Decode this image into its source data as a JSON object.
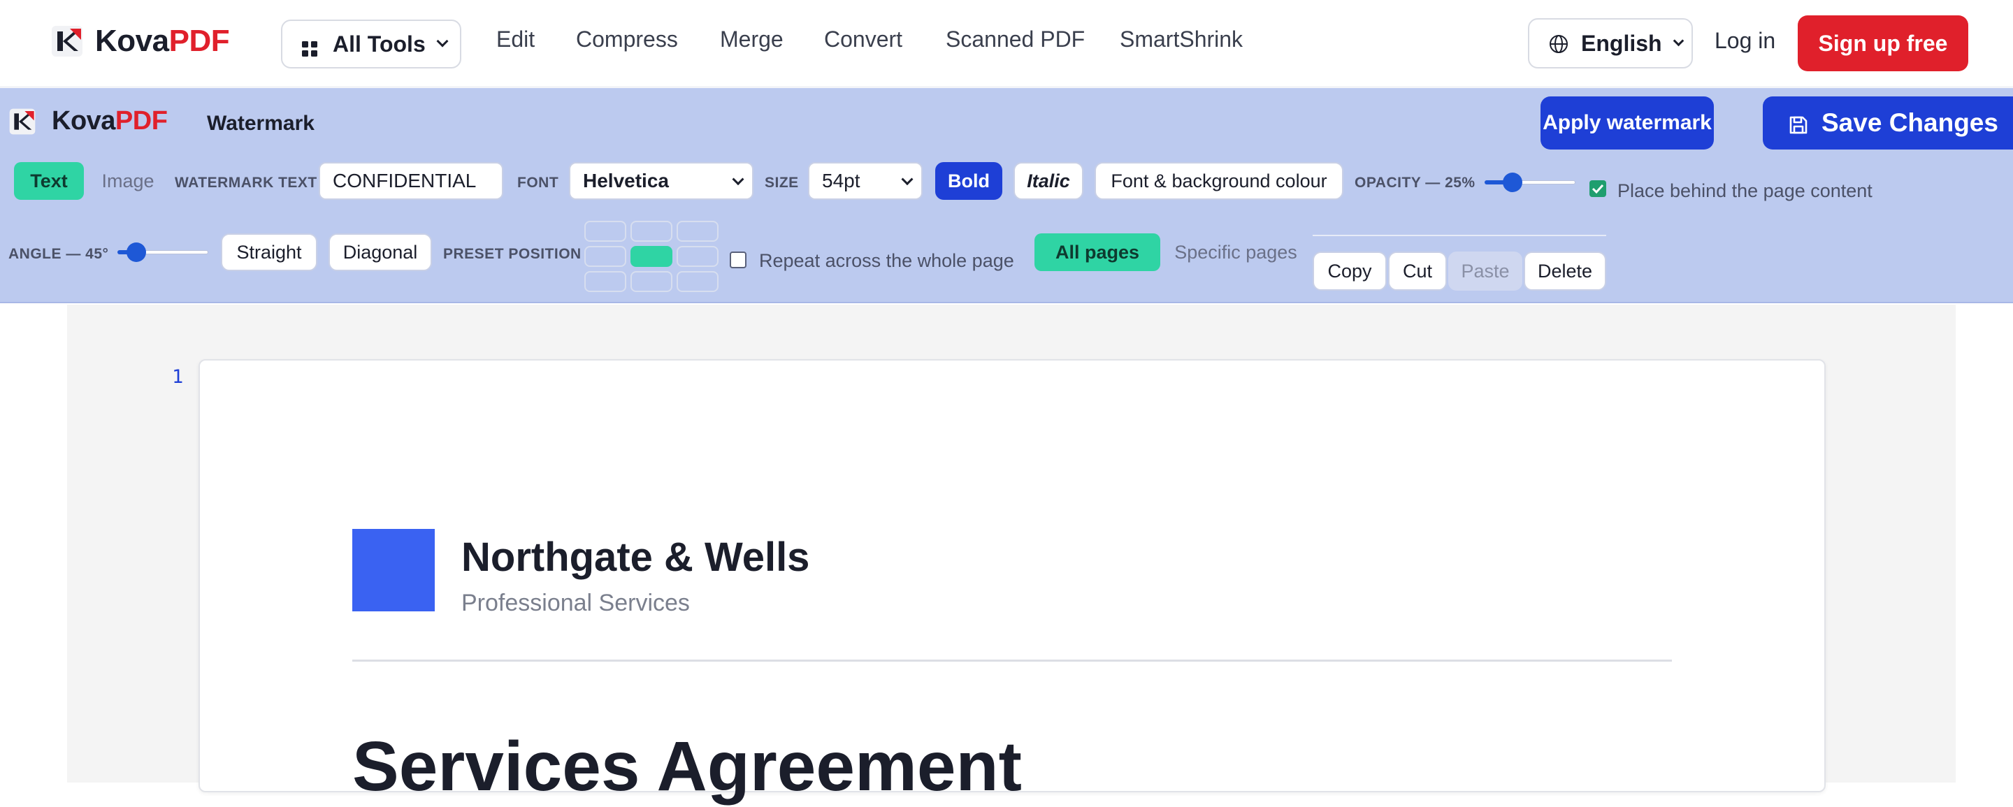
{
  "top_nav": {
    "brand": {
      "part1": "Kova",
      "part2": "PDF"
    },
    "all_tools_label": "All Tools",
    "links": [
      "Edit",
      "Compress",
      "Merge",
      "Convert",
      "Scanned PDF",
      "SmartShrink"
    ],
    "language": "English",
    "login": "Log in",
    "signup": "Sign up free"
  },
  "editor": {
    "brand": {
      "part1": "Kova",
      "part2": "PDF"
    },
    "tool_title": "Watermark",
    "apply_label": "Apply watermark",
    "save_label": "Save Changes",
    "mode_tabs": {
      "text": "Text",
      "image": "Image",
      "selected": "Text"
    },
    "watermark_text_label": "WATERMARK TEXT",
    "watermark_text_value": "CONFIDENTIAL",
    "font_label": "FONT",
    "font_value": "Helvetica",
    "size_label": "SIZE",
    "size_value": "54pt",
    "bold_label": "Bold",
    "bold_active": true,
    "italic_label": "Italic",
    "colour_label": "Font & background colour",
    "opacity_label": "OPACITY — 25%",
    "opacity_value": 25,
    "behind_label": "Place behind the page content",
    "behind_checked": true,
    "angle_label": "ANGLE — 45°",
    "angle_value": 45,
    "straight_label": "Straight",
    "diagonal_label": "Diagonal",
    "preset_label": "PRESET POSITION",
    "preset_selected": "center",
    "repeat_label": "Repeat across the whole page",
    "repeat_checked": false,
    "pages_tabs": {
      "all": "All pages",
      "specific": "Specific pages",
      "selected": "All pages"
    },
    "actions": {
      "copy": "Copy",
      "cut": "Cut",
      "paste": "Paste",
      "delete": "Delete",
      "paste_enabled": false
    }
  },
  "document": {
    "page_number": "1",
    "company_name": "Northgate & Wells",
    "company_subtitle": "Professional Services",
    "title": "Services Agreement"
  },
  "colors": {
    "brand_red": "#e0202b",
    "primary_blue": "#1e3fd6",
    "toolbar_bg": "#bccaef",
    "accent_green": "#2fd4a4",
    "company_logo": "#3a62f2"
  },
  "icons": [
    "kovapdf-logo-icon",
    "grid-icon",
    "chevron-down-icon",
    "globe-icon",
    "save-icon"
  ]
}
